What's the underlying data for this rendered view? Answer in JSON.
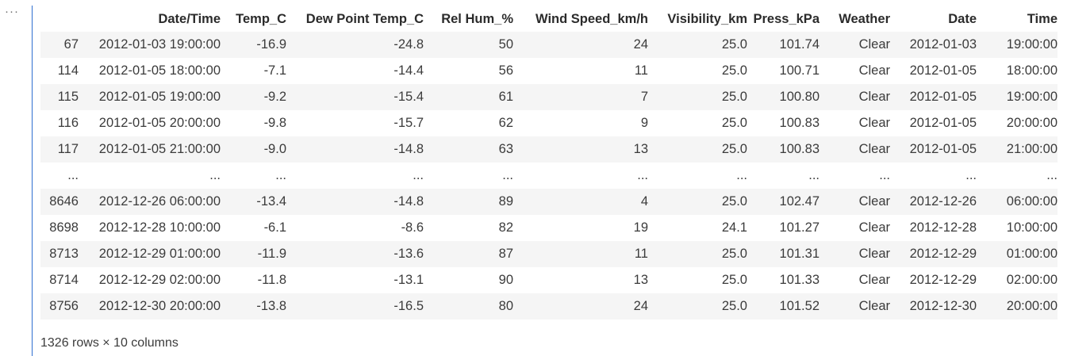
{
  "gutter": {
    "ellipsis": "···"
  },
  "table": {
    "columns": [
      "",
      "Date/Time",
      "Temp_C",
      "Dew Point Temp_C",
      "Rel Hum_%",
      "Wind Speed_km/h",
      "Visibility_km",
      "Press_kPa",
      "Weather",
      "Date",
      "Time"
    ],
    "rows": [
      [
        "67",
        "2012-01-03 19:00:00",
        "-16.9",
        "-24.8",
        "50",
        "24",
        "25.0",
        "101.74",
        "Clear",
        "2012-01-03",
        "19:00:00"
      ],
      [
        "114",
        "2012-01-05 18:00:00",
        "-7.1",
        "-14.4",
        "56",
        "11",
        "25.0",
        "100.71",
        "Clear",
        "2012-01-05",
        "18:00:00"
      ],
      [
        "115",
        "2012-01-05 19:00:00",
        "-9.2",
        "-15.4",
        "61",
        "7",
        "25.0",
        "100.80",
        "Clear",
        "2012-01-05",
        "19:00:00"
      ],
      [
        "116",
        "2012-01-05 20:00:00",
        "-9.8",
        "-15.7",
        "62",
        "9",
        "25.0",
        "100.83",
        "Clear",
        "2012-01-05",
        "20:00:00"
      ],
      [
        "117",
        "2012-01-05 21:00:00",
        "-9.0",
        "-14.8",
        "63",
        "13",
        "25.0",
        "100.83",
        "Clear",
        "2012-01-05",
        "21:00:00"
      ],
      [
        "...",
        "...",
        "...",
        "...",
        "...",
        "...",
        "...",
        "...",
        "...",
        "...",
        "..."
      ],
      [
        "8646",
        "2012-12-26 06:00:00",
        "-13.4",
        "-14.8",
        "89",
        "4",
        "25.0",
        "102.47",
        "Clear",
        "2012-12-26",
        "06:00:00"
      ],
      [
        "8698",
        "2012-12-28 10:00:00",
        "-6.1",
        "-8.6",
        "82",
        "19",
        "24.1",
        "101.27",
        "Clear",
        "2012-12-28",
        "10:00:00"
      ],
      [
        "8713",
        "2012-12-29 01:00:00",
        "-11.9",
        "-13.6",
        "87",
        "11",
        "25.0",
        "101.31",
        "Clear",
        "2012-12-29",
        "01:00:00"
      ],
      [
        "8714",
        "2012-12-29 02:00:00",
        "-11.8",
        "-13.1",
        "90",
        "13",
        "25.0",
        "101.33",
        "Clear",
        "2012-12-29",
        "02:00:00"
      ],
      [
        "8756",
        "2012-12-30 20:00:00",
        "-13.8",
        "-16.5",
        "80",
        "24",
        "25.0",
        "101.52",
        "Clear",
        "2012-12-30",
        "20:00:00"
      ]
    ]
  },
  "summary": "1326 rows × 10 columns",
  "colors": {
    "output_border": "#2f6fd0",
    "stripe": "#f5f5f5"
  }
}
